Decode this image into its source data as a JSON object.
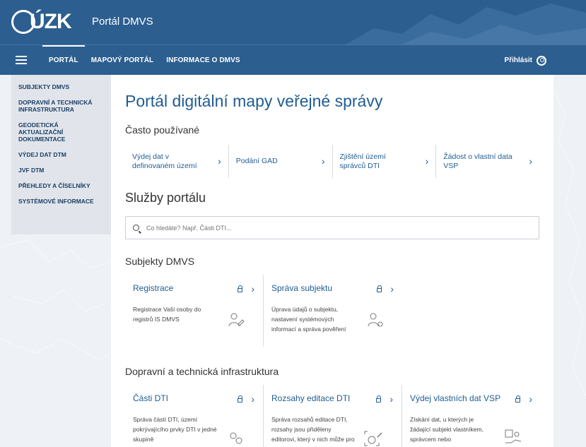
{
  "header": {
    "logo_text": "ÚZK",
    "portal_title": "Portál DMVS"
  },
  "nav": {
    "items": [
      {
        "label": "PORTÁL",
        "active": true
      },
      {
        "label": "MAPOVÝ PORTÁL",
        "active": false
      },
      {
        "label": "INFORMACE O DMVS",
        "active": false
      }
    ],
    "login_label": "Přihlásit"
  },
  "sidebar": {
    "items": [
      {
        "label": "SUBJEKTY DMVS"
      },
      {
        "label": "DOPRAVNÍ A TECHNICKÁ INFRASTRUKTURA"
      },
      {
        "label": "GEODETICKÁ AKTUALIZAČNÍ DOKUMENTACE"
      },
      {
        "label": "VÝDEJ DAT DTM"
      },
      {
        "label": "JVF DTM"
      },
      {
        "label": "PŘEHLEDY A ČÍSELNÍKY"
      },
      {
        "label": "SYSTÉMOVÉ INFORMACE"
      }
    ]
  },
  "main": {
    "title": "Portál digitální mapy veřejné správy",
    "frequent_heading": "Často používané",
    "frequent": [
      {
        "label": "Výdej dat v definovaném území"
      },
      {
        "label": "Podání GAD"
      },
      {
        "label": "Zjištění území správců DTI"
      },
      {
        "label": "Žádost o vlastní data VSP"
      }
    ],
    "services_heading": "Služby portálu",
    "search_placeholder": "Co hledáte? Např. Části DTI...",
    "sections": [
      {
        "heading": "Subjekty DMVS",
        "cards": [
          {
            "title": "Registrace",
            "desc": "Registrace Vaší osoby do registrů IS DMVS",
            "locked": true
          },
          {
            "title": "Správa subjektu",
            "desc": "Úprava údajů o subjektu, nastavení systémových informací a správa pověření",
            "locked": true
          }
        ]
      },
      {
        "heading": "Dopravní a technická infrastruktura",
        "cards": [
          {
            "title": "Části DTI",
            "desc": "Správa částí DTI, území pokrývajícího prvky DTI v jedné skupině",
            "locked": true
          },
          {
            "title": "Rozsahy editace DTI",
            "desc": "Správa rozsahů editace DTI, rozsahy jsou přiděleny editorovi, který v nich může pro daný subjekt",
            "locked": true
          },
          {
            "title": "Výdej vlastních dat VSP",
            "desc": "Získání dat, u kterých je žádající subjekt vlastníkem, správcem nebo provozovatelem",
            "locked": true
          }
        ]
      }
    ]
  },
  "colors": {
    "header_bg": "#2c5e8f",
    "link": "#1f5c93",
    "sidebar_bg": "#e1e5eb"
  }
}
